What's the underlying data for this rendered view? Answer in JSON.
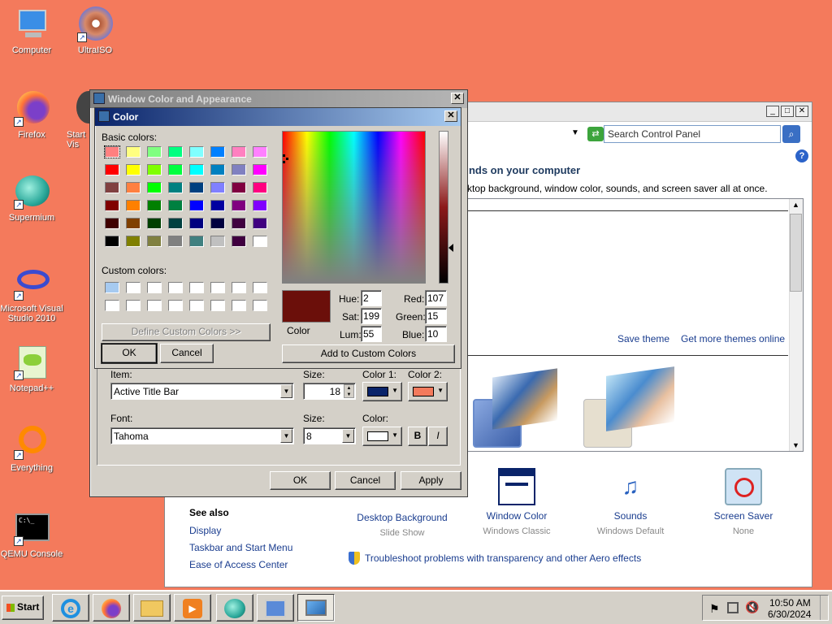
{
  "desktop": {
    "icons": [
      {
        "label": "Computer"
      },
      {
        "label": "UltraISO"
      },
      {
        "label": "Firefox"
      },
      {
        "label": "Start\nVis"
      },
      {
        "label": "Supermium"
      },
      {
        "label": "Microsoft Visual Studio 2010"
      },
      {
        "label": "Notepad++"
      },
      {
        "label": "Everything"
      },
      {
        "label": "QEMU Console"
      }
    ]
  },
  "control_panel": {
    "search_placeholder": "Search Control Panel",
    "heading": "unds on your computer",
    "subheading": "sktop background, window color, sounds, and screen saver all at once.",
    "save_theme": "Save theme",
    "get_more_themes": "Get more themes online",
    "see_also": "See also",
    "see_also_links": [
      "Display",
      "Taskbar and Start Menu",
      "Ease of Access Center"
    ],
    "bottom_items": [
      {
        "label": "Desktop Background",
        "sub": "Slide Show"
      },
      {
        "label": "Window Color",
        "sub": "Windows Classic"
      },
      {
        "label": "Sounds",
        "sub": "Windows Default"
      },
      {
        "label": "Screen Saver",
        "sub": "None"
      }
    ],
    "troubleshoot": "Troubleshoot problems with transparency and other Aero effects"
  },
  "wca": {
    "title": "Window Color and Appearance",
    "item_label": "Item:",
    "item_value": "Active Title Bar",
    "size_label": "Size:",
    "size_value": "18",
    "color1_label": "Color 1:",
    "color2_label": "Color 2:",
    "color1": "#0a246a",
    "color2": "#f47a5c",
    "font_label": "Font:",
    "font_value": "Tahoma",
    "font_size_label": "Size:",
    "font_size_value": "8",
    "font_color_label": "Color:",
    "bold": "B",
    "italic": "I",
    "ok": "OK",
    "cancel": "Cancel",
    "apply": "Apply"
  },
  "color_dialog": {
    "title": "Color",
    "basic_colors_label": "Basic colors:",
    "custom_colors_label": "Custom colors:",
    "define_custom": "Define Custom Colors >>",
    "ok": "OK",
    "cancel": "Cancel",
    "color_solid_label": "Color",
    "selected_color": "#6b0f0a",
    "hue_label": "Hue:",
    "hue": "2",
    "sat_label": "Sat:",
    "sat": "199",
    "lum_label": "Lum:",
    "lum": "55",
    "red_label": "Red:",
    "red": "107",
    "green_label": "Green:",
    "green": "15",
    "blue_label": "Blue:",
    "blue": "10",
    "add_custom": "Add to Custom Colors",
    "basic_colors": [
      "#ff8080",
      "#ffff80",
      "#80ff80",
      "#00ff80",
      "#80ffff",
      "#0080ff",
      "#ff80c0",
      "#ff80ff",
      "#ff0000",
      "#ffff00",
      "#80ff00",
      "#00ff40",
      "#00ffff",
      "#0080c0",
      "#8080c0",
      "#ff00ff",
      "#804040",
      "#ff8040",
      "#00ff00",
      "#008080",
      "#004080",
      "#8080ff",
      "#800040",
      "#ff0080",
      "#800000",
      "#ff8000",
      "#008000",
      "#008040",
      "#0000ff",
      "#0000a0",
      "#800080",
      "#8000ff",
      "#400000",
      "#804000",
      "#004000",
      "#004040",
      "#000080",
      "#000040",
      "#400040",
      "#400080",
      "#000000",
      "#808000",
      "#808040",
      "#808080",
      "#408080",
      "#c0c0c0",
      "#400040",
      "#ffffff"
    ],
    "custom_colors": [
      "#a6caf0",
      "#ffffff",
      "#ffffff",
      "#ffffff",
      "#ffffff",
      "#ffffff",
      "#ffffff",
      "#ffffff",
      "#ffffff",
      "#ffffff",
      "#ffffff",
      "#ffffff",
      "#ffffff",
      "#ffffff",
      "#ffffff",
      "#ffffff"
    ]
  },
  "taskbar": {
    "start": "Start",
    "time": "10:50 AM",
    "date": "6/30/2024"
  }
}
